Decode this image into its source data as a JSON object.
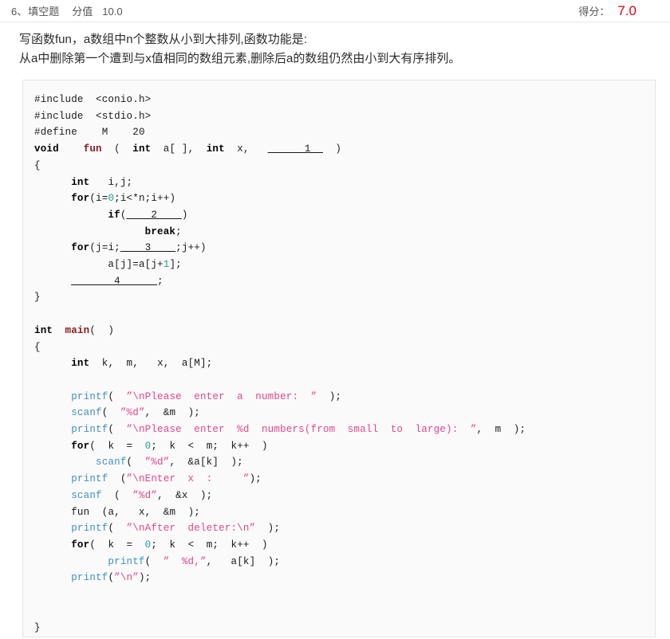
{
  "header": {
    "question_index": "6、",
    "question_type": "填空题",
    "points_label": "分值",
    "points_value": "10.0",
    "score_label": "得分：",
    "score_value": "7.0",
    "score_color": "#e60012"
  },
  "stem": {
    "line1": "写函数fun，a数组中n个整数从小到大排列,函数功能是:",
    "line2": "从a中删除第一个遭到与x值相同的数组元素,删除后a的数组仍然由小到大有序排列。"
  },
  "code": {
    "lines": [
      "#include  <conio.h>",
      "#include  <stdio.h>",
      "#define    M    20",
      "void    fun  (  int  a[ ],  int  x,   ______1__  )",
      "{",
      "      int   i,j;",
      "      for(i=0;i<*n;i++)",
      "            if(____2____)",
      "                  break;",
      "      for(j=i;____3____;j++)",
      "            a[j]=a[j+1];",
      "      _______4______;",
      "}",
      "",
      "int  main(  )",
      "{",
      "      int  k,  m,   x,  a[M];",
      "",
      "      printf(  \"\\nPlease  enter  a  number:  \"  );",
      "      scanf(  \"%d\",  &m  );",
      "      printf(  \"\\nPlease  enter  %d  numbers(from  small  to  large):  \",  m  );",
      "      for(  k  =  0;  k  <  m;  k++  )",
      "          scanf(  \"%d\",  &a[k]  );",
      "      printf  (\"\\nEnter  x  :     \");",
      "      scanf  (  \"%d\",  &x  );",
      "      fun  (a,   x,  &m  );",
      "      printf(  \"\\nAfter  deleter:\\n\"  );",
      "      for(  k  =  0;  k  <  m;  k++  )",
      "            printf(  \"  %d,\",   a[k]  );",
      "      printf(\"\\n\");",
      "",
      "",
      "}"
    ],
    "blanks": [
      "1",
      "2",
      "3",
      "4"
    ],
    "function_name": "fun",
    "main_name": "main",
    "constant_name": "M",
    "constant_value": "20",
    "includes": [
      "conio.h",
      "stdio.h"
    ],
    "colors": {
      "keyword": "#000000",
      "function_def": "#8b1a1a",
      "io_function": "#3f8fbf",
      "string": "#e0468c",
      "number": "#1d9e8e",
      "text": "#1a1a1a",
      "background": "#fafafa",
      "border": "#e3e3e3"
    }
  }
}
